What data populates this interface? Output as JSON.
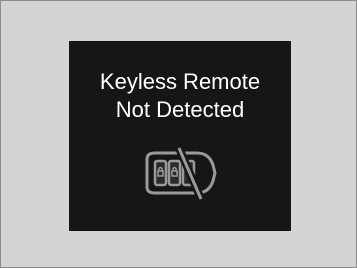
{
  "display": {
    "message_line_1": "Keyless Remote",
    "message_line_2": "Not Detected",
    "icon": "keyless-remote-not-detected-icon"
  },
  "colors": {
    "screen_background": "#161616",
    "page_background": "#d4d4d4",
    "text": "#ffffff",
    "icon_stroke": "#9a9a9a"
  }
}
